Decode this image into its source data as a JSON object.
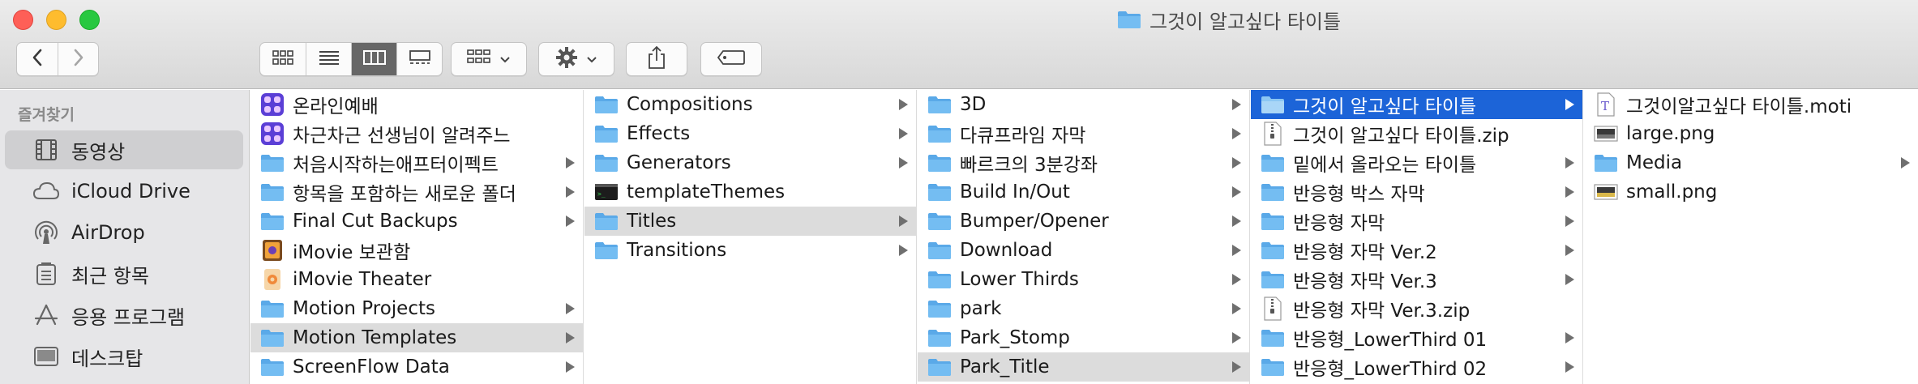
{
  "window": {
    "title": "그것이 알고싶다 타이틀"
  },
  "sidebar": {
    "header": "즐겨찾기",
    "items": [
      {
        "label": "동영상",
        "icon": "film-icon",
        "selected": true
      },
      {
        "label": "iCloud Drive",
        "icon": "cloud-icon",
        "selected": false
      },
      {
        "label": "AirDrop",
        "icon": "airdrop-icon",
        "selected": false
      },
      {
        "label": "최근 항목",
        "icon": "recents-icon",
        "selected": false
      },
      {
        "label": "응용 프로그램",
        "icon": "applications-icon",
        "selected": false
      },
      {
        "label": "데스크탑",
        "icon": "desktop-icon",
        "selected": false
      }
    ]
  },
  "columns": [
    {
      "items": [
        {
          "label": "온라인예배",
          "icon": "shortcuts-app-icon",
          "arrow": false
        },
        {
          "label": "차근차근 선생님이 알려주느",
          "icon": "shortcuts-app-icon",
          "arrow": false
        },
        {
          "label": "처음시작하는애프터이펙트",
          "icon": "folder-icon",
          "arrow": true
        },
        {
          "label": "항목을 포함하는 새로운 폴더",
          "icon": "folder-icon",
          "arrow": true
        },
        {
          "label": "Final Cut Backups",
          "icon": "folder-icon",
          "arrow": true
        },
        {
          "label": "iMovie 보관함",
          "icon": "imovie-library-icon",
          "arrow": false
        },
        {
          "label": "iMovie Theater",
          "icon": "imovie-theater-icon",
          "arrow": false
        },
        {
          "label": "Motion Projects",
          "icon": "folder-icon",
          "arrow": true
        },
        {
          "label": "Motion Templates",
          "icon": "folder-icon",
          "arrow": true,
          "selected": "grey"
        },
        {
          "label": "ScreenFlow Data",
          "icon": "folder-icon",
          "arrow": true
        }
      ]
    },
    {
      "items": [
        {
          "label": "Compositions",
          "icon": "folder-icon",
          "arrow": true
        },
        {
          "label": "Effects",
          "icon": "folder-icon",
          "arrow": true
        },
        {
          "label": "Generators",
          "icon": "folder-icon",
          "arrow": true
        },
        {
          "label": "templateThemes",
          "icon": "terminal-file-icon",
          "arrow": false
        },
        {
          "label": "Titles",
          "icon": "folder-icon",
          "arrow": true,
          "selected": "grey"
        },
        {
          "label": "Transitions",
          "icon": "folder-icon",
          "arrow": true
        }
      ]
    },
    {
      "items": [
        {
          "label": "3D",
          "icon": "folder-icon",
          "arrow": true
        },
        {
          "label": "다큐프라임 자막",
          "icon": "folder-icon",
          "arrow": true
        },
        {
          "label": "빠르크의 3분강좌",
          "icon": "folder-icon",
          "arrow": true
        },
        {
          "label": "Build In/Out",
          "icon": "folder-icon",
          "arrow": true
        },
        {
          "label": "Bumper/Opener",
          "icon": "folder-icon",
          "arrow": true
        },
        {
          "label": "Download",
          "icon": "folder-icon",
          "arrow": true
        },
        {
          "label": "Lower Thirds",
          "icon": "folder-icon",
          "arrow": true
        },
        {
          "label": "park",
          "icon": "folder-icon",
          "arrow": true
        },
        {
          "label": "Park_Stomp",
          "icon": "folder-icon",
          "arrow": true
        },
        {
          "label": "Park_Title",
          "icon": "folder-icon",
          "arrow": true,
          "selected": "grey"
        }
      ]
    },
    {
      "items": [
        {
          "label": "그것이 알고싶다 타이틀",
          "icon": "folder-icon",
          "arrow": true,
          "selected": "blue"
        },
        {
          "label": "그것이 알고싶다 타이틀.zip",
          "icon": "zip-file-icon",
          "arrow": false
        },
        {
          "label": "밑에서 올라오는 타이틀",
          "icon": "folder-icon",
          "arrow": true
        },
        {
          "label": "반응형 박스 자막",
          "icon": "folder-icon",
          "arrow": true
        },
        {
          "label": "반응형 자막",
          "icon": "folder-icon",
          "arrow": true
        },
        {
          "label": "반응형 자막 Ver.2",
          "icon": "folder-icon",
          "arrow": true
        },
        {
          "label": "반응형 자막 Ver.3",
          "icon": "folder-icon",
          "arrow": true
        },
        {
          "label": "반응형 자막 Ver.3.zip",
          "icon": "zip-file-icon",
          "arrow": false
        },
        {
          "label": "반응형_LowerThird 01",
          "icon": "folder-icon",
          "arrow": true
        },
        {
          "label": "반응형_LowerThird 02",
          "icon": "folder-icon",
          "arrow": true
        }
      ]
    },
    {
      "items": [
        {
          "label": "그것이알고싶다 타이틀.moti",
          "icon": "motion-title-file-icon",
          "arrow": false
        },
        {
          "label": "large.png",
          "icon": "image-file-icon",
          "arrow": false
        },
        {
          "label": "Media",
          "icon": "folder-icon",
          "arrow": true
        },
        {
          "label": "small.png",
          "icon": "image-file-icon",
          "arrow": false
        }
      ]
    }
  ],
  "colors": {
    "selection_blue": "#1c64d8",
    "selection_grey": "#dcdcdc",
    "folder_blue": "#6ab5ef"
  }
}
